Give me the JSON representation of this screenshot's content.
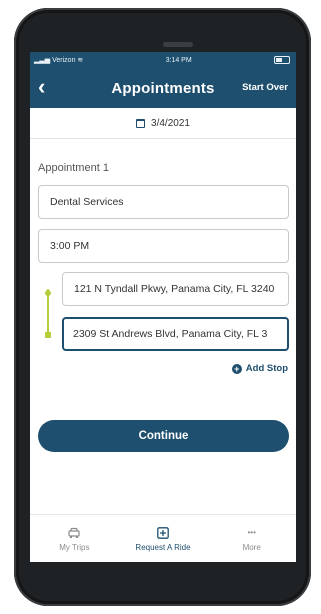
{
  "statusbar": {
    "carrier": "Verizon",
    "time": "3:14 PM"
  },
  "header": {
    "back_icon": "chevron-left-icon",
    "title": "Appointments",
    "start_over": "Start Over"
  },
  "date": {
    "icon": "calendar-icon",
    "value": "3/4/2021"
  },
  "appointment": {
    "label": "Appointment 1",
    "service": "Dental Services",
    "time": "3:00 PM",
    "pickup": "121 N Tyndall Pkwy, Panama City, FL 3240",
    "dropoff": "2309 St Andrews Blvd, Panama City, FL 3"
  },
  "add_stop": "Add Stop",
  "continue": "Continue",
  "tabs": [
    {
      "label": "My Trips",
      "icon": "car-icon"
    },
    {
      "label": "Request A Ride",
      "icon": "plus-square-icon"
    },
    {
      "label": "More",
      "icon": "ellipsis-icon"
    }
  ],
  "colors": {
    "primary": "#1e4f6e",
    "route": "#b3cf3c"
  }
}
